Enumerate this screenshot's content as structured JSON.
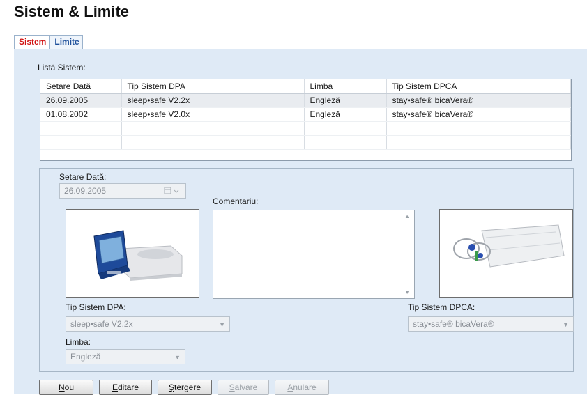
{
  "title": "Sistem & Limite",
  "tabs": [
    {
      "label": "Sistem",
      "active": true
    },
    {
      "label": "Limite",
      "active": false
    }
  ],
  "list": {
    "label": "Listă Sistem:",
    "columns": [
      "Setare Dată",
      "Tip Sistem DPA",
      "Limba",
      "Tip Sistem DPCA"
    ],
    "rows": [
      [
        "26.09.2005",
        "sleep•safe V2.2x",
        "Engleză",
        "stay•safe® bicaVera®"
      ],
      [
        "01.08.2002",
        "sleep•safe V2.0x",
        "Engleză",
        "stay•safe® bicaVera®"
      ]
    ],
    "selected_row": 0
  },
  "detail": {
    "date_label": "Setare Dată:",
    "date_value": "26.09.2005",
    "comment_label": "Comentariu:",
    "comment_value": "",
    "apd_label": "Tip Sistem DPA:",
    "apd_value": "sleep•safe V2.2x",
    "language_label": "Limba:",
    "language_value": "Engleză",
    "capd_label": "Tip Sistem DPCA:",
    "capd_value": "stay•safe® bicaVera®"
  },
  "buttons": {
    "new": {
      "accel": "N",
      "rest": "ou"
    },
    "edit": {
      "accel": "E",
      "rest": "ditare"
    },
    "delete": {
      "accel": "Ș",
      "rest": "tergere"
    },
    "save": {
      "accel": "S",
      "rest": "alvare"
    },
    "cancel": {
      "accel": "A",
      "rest": "nulare"
    }
  },
  "colors": {
    "panel_bg": "#dfeaf6",
    "active_tab": "#d01010",
    "inactive_tab": "#1d4f9a"
  }
}
